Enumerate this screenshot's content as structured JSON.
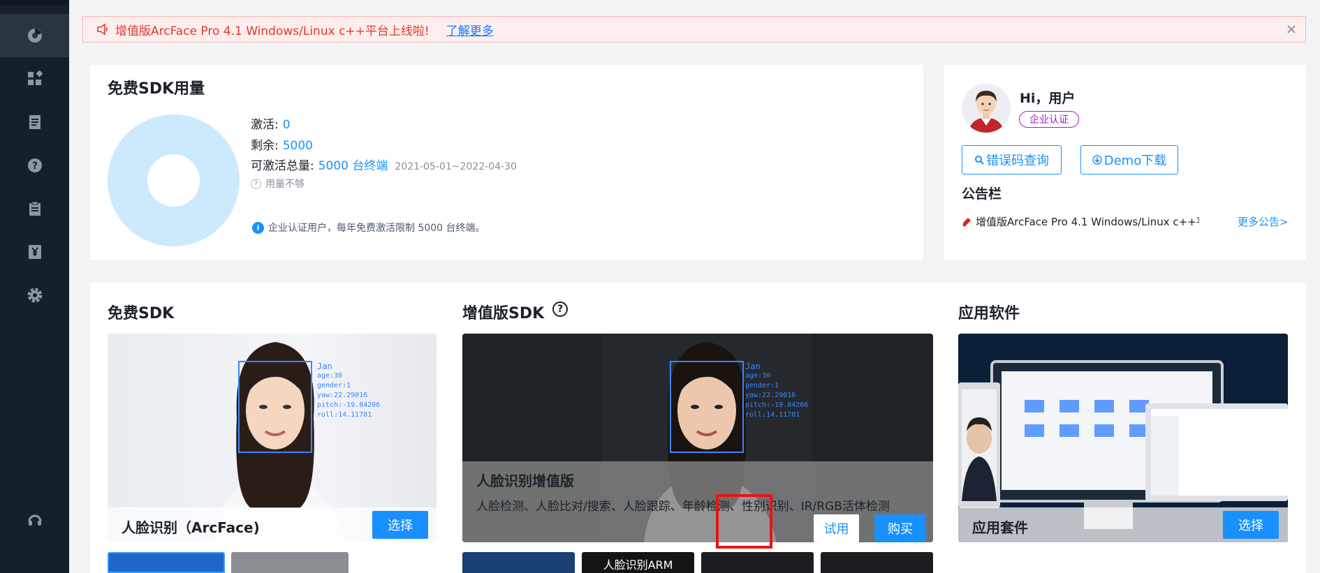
{
  "sidebar": {
    "items": [
      {
        "icon": "dashboard-icon"
      },
      {
        "icon": "apps-grid-icon"
      },
      {
        "icon": "document-icon"
      },
      {
        "icon": "help-icon"
      },
      {
        "icon": "clipboard-icon"
      },
      {
        "icon": "yen-icon"
      },
      {
        "icon": "settings-icon"
      },
      {
        "icon": "headset-icon"
      }
    ]
  },
  "banner": {
    "text": "增值版ArcFace Pro 4.1 Windows/Linux c++平台上线啦!",
    "link": "了解更多",
    "color": "#e0392e"
  },
  "usage": {
    "title": "免费SDK用量",
    "activated_label": "激活:",
    "activated_value": "0",
    "remaining_label": "剩余:",
    "remaining_value": "5000",
    "total_label": "可激活总量:",
    "total_value": "5000 台终端",
    "date_range": "2021-05-01~2022-04-30",
    "not_enough": "用量不够",
    "note": "企业认证用户，每年免费激活限制 5000 台终端。"
  },
  "user": {
    "greeting": "Hi，用户",
    "badge": "企业认证",
    "error_code_button": "错误码查询",
    "demo_button": "Demo下载",
    "notice_title": "公告栏",
    "notice_item": "增值版ArcFace Pro 4.1 Windows/Linux c++平台...",
    "notice_more": "更多公告>"
  },
  "sdk": {
    "free_title": "免费SDK",
    "pro_title": "增值版SDK",
    "app_title": "应用软件",
    "free_panel": {
      "name": "人脸识别（ArcFace)",
      "button": "选择",
      "hud": [
        "Jan",
        "age:30",
        "gender:1",
        "yaw:22.29016",
        "pitch:-19.84206",
        "roll:14.11781"
      ]
    },
    "pro_panel": {
      "name": "人脸识别增值版",
      "desc": "人脸检测、人脸比对/搜索、人脸跟踪、年龄检测、性别识别、IR/RGB活体检测",
      "trial_button": "试用",
      "buy_button": "购买",
      "hud": [
        "Jan",
        "age:30",
        "gender:1",
        "yaw:22.29016",
        "pitch:-19.84206",
        "roll:14.11781"
      ]
    },
    "app_panel": {
      "name": "应用套件",
      "button": "选择"
    },
    "thumbs": [
      {
        "label": ""
      },
      {
        "label": ""
      },
      {
        "label": ""
      },
      {
        "label": "人脸识别ARM"
      },
      {
        "label": ""
      },
      {
        "label": ""
      }
    ]
  },
  "colors": {
    "primary": "#1890ff",
    "sidebar": "#15202b",
    "highlight": "#e81414"
  }
}
